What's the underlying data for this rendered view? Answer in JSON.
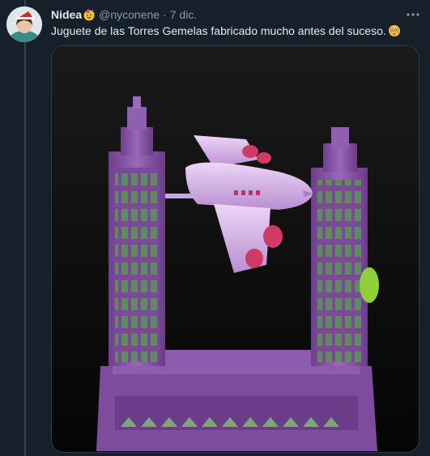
{
  "tweet": {
    "author_name": "Nidea",
    "author_emoji": "partying-face",
    "handle": "@nyconene",
    "separator": "·",
    "time": "7 dic.",
    "text": "Juguete de las Torres Gemelas fabricado mucho antes del suceso.",
    "text_emoji": "flushed-face",
    "media": {
      "type": "photo",
      "subject": "purple toy of two towers with an airplane between them"
    }
  },
  "icons": {
    "more": "more-horizontal-icon"
  },
  "colors": {
    "background": "#15202b",
    "text_primary": "#e7e9ea",
    "text_secondary": "#8b98a5",
    "toy_purple": "#8a5aa8",
    "plane_lavender": "#d9b8ec"
  }
}
